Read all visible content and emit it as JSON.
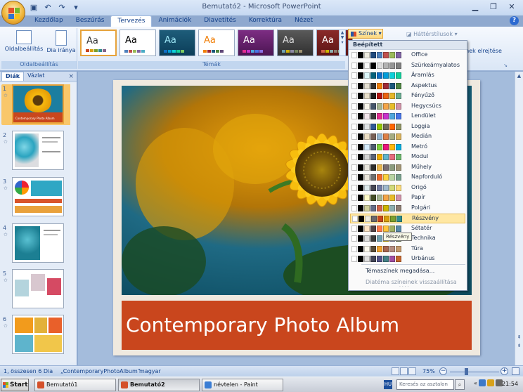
{
  "window": {
    "title": "Bemutató2 - Microsoft PowerPoint",
    "quick_access": [
      "save-icon",
      "undo-icon",
      "redo-icon",
      "customize-icon"
    ],
    "controls": [
      "minimize-icon",
      "restore-icon",
      "close-icon"
    ]
  },
  "ribbon": {
    "tabs": [
      "Kezdőlap",
      "Beszúrás",
      "Tervezés",
      "Animációk",
      "Diavetítés",
      "Korrektúra",
      "Nézet"
    ],
    "active_tab": "Tervezés",
    "groups": {
      "page_setup": {
        "label": "Oldalbeállítás",
        "page_setup_button": "Oldalbeállítás",
        "orientation_button": "Dia iránya"
      },
      "themes": {
        "label": "Témák",
        "thumb_label": "Aa"
      },
      "background": {
        "colors_button": "Színek",
        "bg_styles": "Háttérstílusok",
        "hide_bg": "einek elrejtése"
      }
    }
  },
  "slides_pane": {
    "tabs": [
      "Diák",
      "Vázlat"
    ],
    "active_tab": "Diák",
    "close": "×",
    "slides": [
      {
        "number": "1",
        "caption": "Contemporary Photo Album"
      },
      {
        "number": "2"
      },
      {
        "number": "3"
      },
      {
        "number": "4"
      },
      {
        "number": "5"
      },
      {
        "number": "6"
      }
    ]
  },
  "slide": {
    "title": "Contemporary Photo Album"
  },
  "colors_menu": {
    "header": "Beépített",
    "items": [
      {
        "name": "Office",
        "colors": [
          "#ffffff",
          "#000000",
          "#eeece1",
          "#1f497d",
          "#4f81bd",
          "#c0504d",
          "#9bbb59",
          "#8064a2",
          "#4bacc6",
          "#f79646"
        ]
      },
      {
        "name": "Szürkeárnyalatos",
        "colors": [
          "#ffffff",
          "#000000",
          "#f8f8f8",
          "#000000",
          "#dddddd",
          "#b2b2b2",
          "#969696",
          "#808080",
          "#5f5f5f",
          "#4d4d4d"
        ]
      },
      {
        "name": "Áramlás",
        "colors": [
          "#ffffff",
          "#000000",
          "#dbf5f9",
          "#04617b",
          "#0f6fc6",
          "#009dd9",
          "#0bd0d9",
          "#10cf9b",
          "#7cca62",
          "#a5c249"
        ]
      },
      {
        "name": "Aspektus",
        "colors": [
          "#ffffff",
          "#000000",
          "#e3ded1",
          "#323232",
          "#f07f09",
          "#9f2936",
          "#1b587c",
          "#4e8542",
          "#604878",
          "#c19859"
        ]
      },
      {
        "name": "Fényűző",
        "colors": [
          "#ffffff",
          "#000000",
          "#e7dec9",
          "#1d1d1d",
          "#b01513",
          "#ea6312",
          "#e6b729",
          "#6aac90",
          "#5f9c9d",
          "#9e5e9b"
        ]
      },
      {
        "name": "Hegycsúcs",
        "colors": [
          "#ffffff",
          "#000000",
          "#f8f5eb",
          "#44546a",
          "#a5b592",
          "#f3a447",
          "#e7bc29",
          "#d092a7",
          "#9c85c0",
          "#809ec2"
        ]
      },
      {
        "name": "Lendület",
        "colors": [
          "#ffffff",
          "#000000",
          "#f4e7ed",
          "#3b3b3b",
          "#e32d91",
          "#c830cc",
          "#4ea6dc",
          "#4775e7",
          "#8971e1",
          "#d54773"
        ]
      },
      {
        "name": "Loggia",
        "colors": [
          "#ffffff",
          "#000000",
          "#dfe3e5",
          "#2f5897",
          "#94c600",
          "#71685a",
          "#ff6700",
          "#909465",
          "#956b43",
          "#fea022"
        ]
      },
      {
        "name": "Medián",
        "colors": [
          "#ffffff",
          "#000000",
          "#ebddc3",
          "#775f55",
          "#94b6d2",
          "#dd8047",
          "#a5ab81",
          "#d8b25c",
          "#7ba79d",
          "#968c8c"
        ]
      },
      {
        "name": "Metró",
        "colors": [
          "#ffffff",
          "#000000",
          "#d6ecff",
          "#4e5b6f",
          "#7fd13b",
          "#ea157a",
          "#feb80a",
          "#00addc",
          "#738ac8",
          "#1ab39f"
        ]
      },
      {
        "name": "Modul",
        "colors": [
          "#ffffff",
          "#000000",
          "#d4d4d4",
          "#5a6378",
          "#f0ad00",
          "#60b5cc",
          "#e66c7d",
          "#6bb76d",
          "#e88651",
          "#c64847"
        ]
      },
      {
        "name": "Műhely",
        "colors": [
          "#ffffff",
          "#000000",
          "#e7e5dd",
          "#2c2c2c",
          "#e8b54d",
          "#786c71",
          "#8b9b7d",
          "#a19574",
          "#b3906b",
          "#b86d5d"
        ]
      },
      {
        "name": "Napforduló",
        "colors": [
          "#ffffff",
          "#000000",
          "#e9e5dc",
          "#6e6e6e",
          "#ef6a28",
          "#fbd23c",
          "#b8d4a2",
          "#76a08b",
          "#8f5a8f",
          "#6a90b1"
        ]
      },
      {
        "name": "Origó",
        "colors": [
          "#ffffff",
          "#000000",
          "#dde9ec",
          "#464653",
          "#727ca3",
          "#9fb8cd",
          "#d2da7a",
          "#fada7a",
          "#b88472",
          "#8e736a"
        ]
      },
      {
        "name": "Papír",
        "colors": [
          "#ffffff",
          "#000000",
          "#fefac9",
          "#444d26",
          "#a5b592",
          "#f3a447",
          "#e7bc29",
          "#d092a7",
          "#9c85c0",
          "#809ec2"
        ]
      },
      {
        "name": "Polgári",
        "colors": [
          "#ffffff",
          "#000000",
          "#cccc99",
          "#646b86",
          "#d16349",
          "#ccb400",
          "#8cadae",
          "#8c7b70",
          "#8fb08c",
          "#d19049"
        ]
      },
      {
        "name": "Részvény",
        "colors": [
          "#ffffff",
          "#000000",
          "#eeece1",
          "#69676d",
          "#c9461d",
          "#d89f0e",
          "#7b9f2c",
          "#2d8c8e",
          "#84658b",
          "#a16e4c"
        ]
      },
      {
        "name": "Sétatér",
        "colors": [
          "#ffffff",
          "#000000",
          "#fce2c4",
          "#524246",
          "#ff7b4c",
          "#ffc43b",
          "#a0b062",
          "#588aa8",
          "#cf5a4c",
          "#ad805f"
        ]
      },
      {
        "name": "Technika",
        "colors": [
          "#ffffff",
          "#000000",
          "#d9d9d9",
          "#3b3b3b",
          "#6ea0b0",
          "#ccaf0a",
          "#8d89a4",
          "#748560",
          "#9e9273",
          "#7e848d"
        ]
      },
      {
        "name": "Túra",
        "colors": [
          "#ffffff",
          "#000000",
          "#fbf8ed",
          "#584c39",
          "#f0a22e",
          "#a5644e",
          "#b58b80",
          "#c3986d",
          "#a19574",
          "#c17529"
        ]
      },
      {
        "name": "Urbánus",
        "colors": [
          "#ffffff",
          "#000000",
          "#dedede",
          "#424456",
          "#53548a",
          "#438086",
          "#a04da3",
          "#c4652d",
          "#8b5d3d",
          "#5c92b5"
        ]
      }
    ],
    "highlighted": "Részvény",
    "create_new": "Témaszínek megadása...",
    "reset": "Diatéma színeinek visszaállítása",
    "tooltip": "Részvény"
  },
  "status_bar": {
    "slide_info": "1, összesen 6 Dia",
    "theme_name": "„ContemporaryPhotoAlbum”",
    "language": "magyar",
    "zoom": "75%",
    "zoom_minus": "−",
    "zoom_plus": "+"
  },
  "taskbar": {
    "start": "Start",
    "tasks": [
      {
        "label": "Bemutató1",
        "active": false
      },
      {
        "label": "Bemutató2",
        "active": true
      },
      {
        "label": "névtelen - Paint",
        "active": false
      }
    ],
    "lang": "HU",
    "search_placeholder": "Keresés az asztalon",
    "tray_chevron": "«",
    "clock": "21:54"
  },
  "theme_colors": {
    "accent_orange": "#c9461d",
    "ribbon_blue": "#15428b",
    "highlight": "#ffe7a2"
  }
}
